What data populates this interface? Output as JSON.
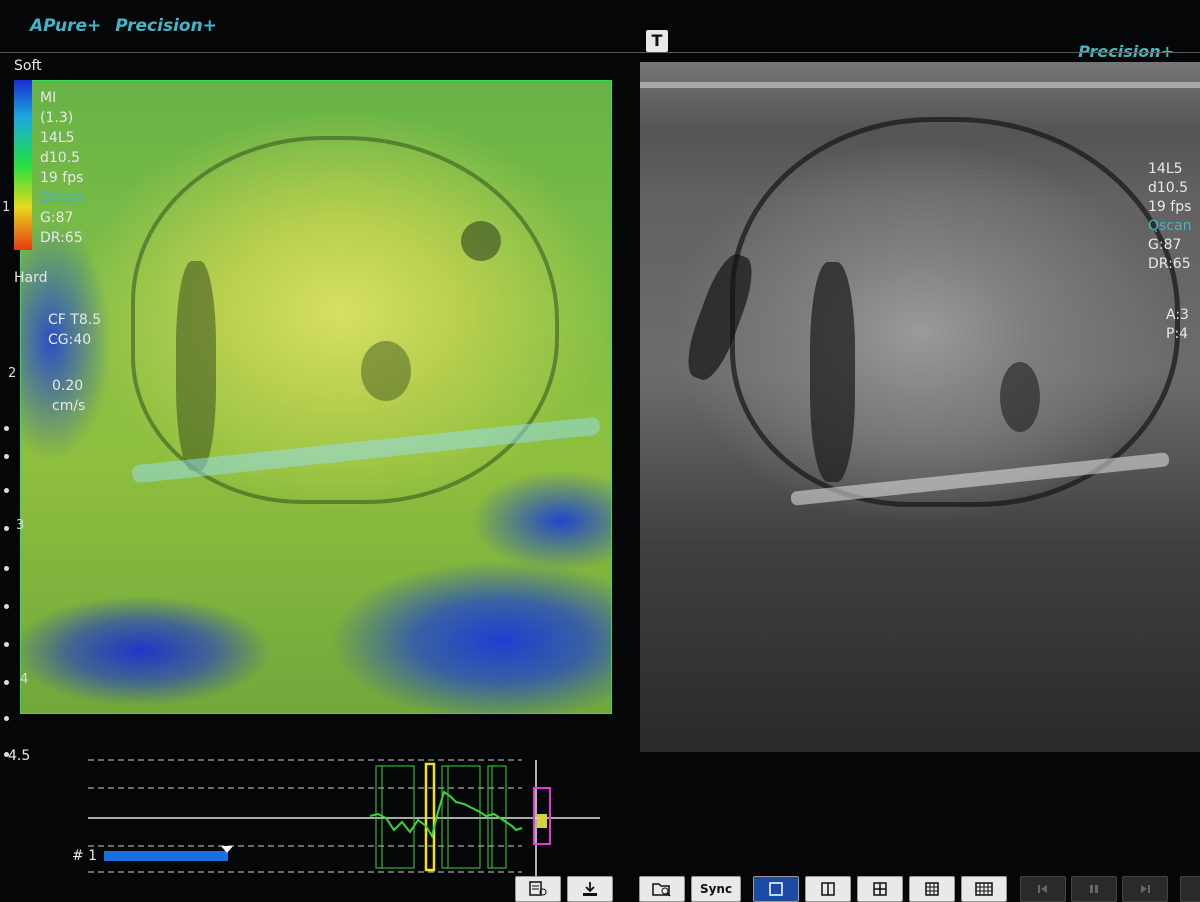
{
  "header": {
    "left_labels": [
      "APure+",
      "Precision+"
    ],
    "right_label": "Precision+",
    "t_button": "T"
  },
  "left_panel": {
    "scale_top": "Soft",
    "scale_bottom": "Hard",
    "params": [
      "MI",
      "(1.3)",
      "14L5",
      "d10.5",
      "19 fps",
      "Qscan",
      "G:87",
      "DR:65"
    ],
    "cf": [
      "CF T8.5",
      "CG:40"
    ],
    "velocity": [
      "0.20",
      "cm/s"
    ]
  },
  "right_panel": {
    "params": [
      "14L5",
      "d10.5",
      "19 fps",
      "Qscan",
      "G:87",
      "DR:65"
    ],
    "extra": [
      "A:3",
      "P:4"
    ]
  },
  "depth_scale": [
    "1",
    "2",
    "3",
    "4",
    "4.5"
  ],
  "waveform": {
    "trace_label": "# 1",
    "line_color": "#39d63a",
    "marker_color": "#f2e21a",
    "box_color": "#e33ad6"
  },
  "toolbar": {
    "sync_label": "Sync"
  },
  "colors": {
    "accent": "#3fb7c9",
    "frame_green": "#29e05a",
    "toolbar_active": "#1c4ba3"
  }
}
